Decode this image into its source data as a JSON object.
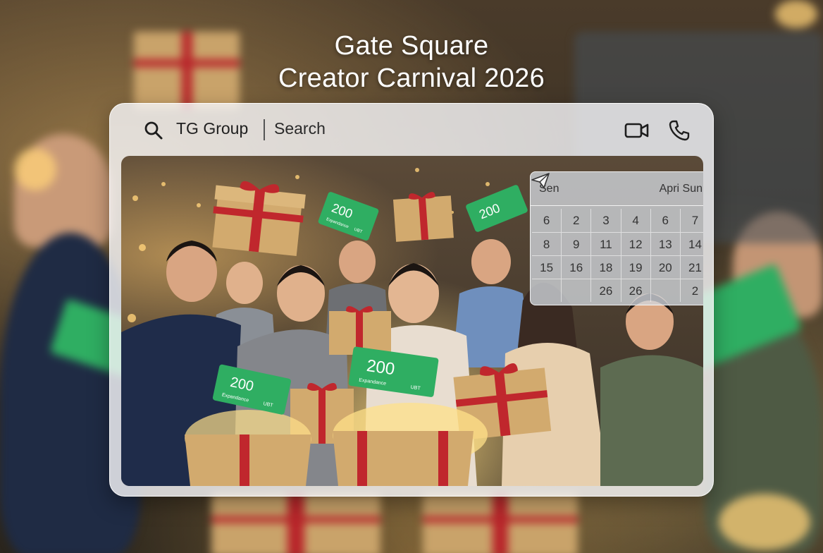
{
  "headline": {
    "line1": "Gate Square",
    "line2": "Creator Carnival 2026"
  },
  "topbar": {
    "search_icon": "search-icon",
    "group_name": "TG Group",
    "search_label": "Search",
    "video_icon": "video-camera-icon",
    "phone_icon": "phone-icon"
  },
  "calendar": {
    "left_label": "Sen",
    "right_label": "Apri Sun",
    "send_icon": "paper-plane-icon",
    "rows": [
      [
        "6",
        "2",
        "3",
        "4",
        "6",
        "7"
      ],
      [
        "8",
        "9",
        "11",
        "12",
        "13",
        "14"
      ],
      [
        "15",
        "16",
        "18",
        "19",
        "20",
        "21"
      ],
      [
        "",
        "",
        "26",
        "26",
        "",
        "2"
      ]
    ]
  },
  "tickets": [
    {
      "amount": "200",
      "subtitle": "Expandance",
      "tag": "UBT"
    },
    {
      "amount": "200",
      "subtitle": "",
      "tag": ""
    },
    {
      "amount": "200",
      "subtitle": "Expandance",
      "tag": "UBT"
    },
    {
      "amount": "200",
      "subtitle": "Expandance",
      "tag": "UBT"
    }
  ],
  "colors": {
    "ticket_green": "#2fae62",
    "ribbon_red": "#c0272d",
    "gift_kraft": "#d2aa6e"
  }
}
